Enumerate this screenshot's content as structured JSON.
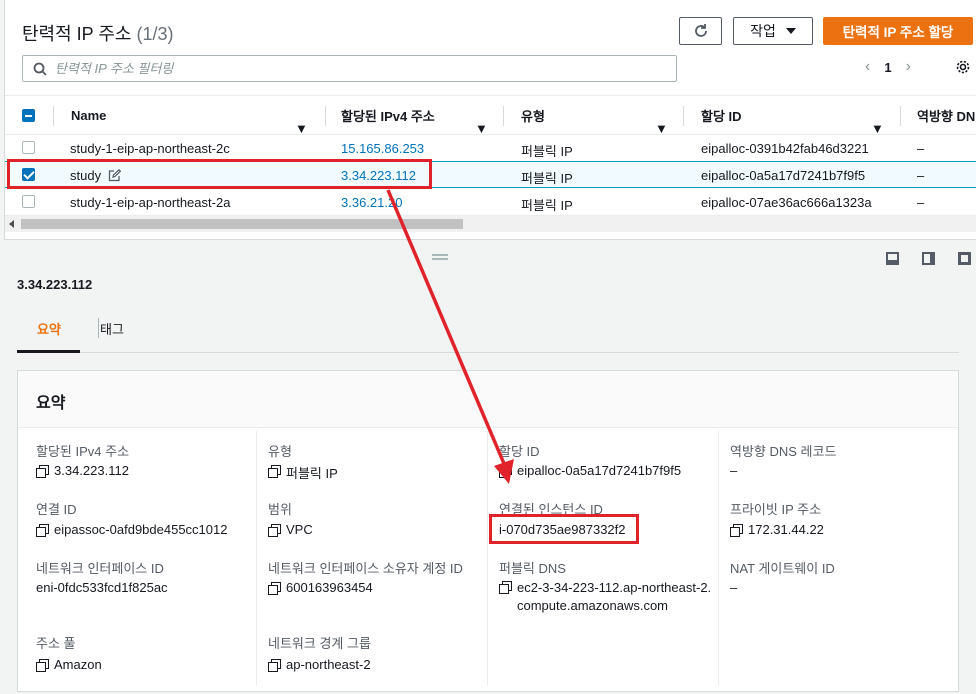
{
  "list": {
    "title": "탄력적 IP 주소",
    "count": "(1/3)",
    "actions_label": "작업",
    "allocate_label": "탄력적 IP 주소 할당",
    "filter_placeholder": "탄력적 IP 주소 필터링",
    "page_number": "1",
    "columns": [
      "Name",
      "할당된 IPv4 주소",
      "유형",
      "할당 ID",
      "역방향 DN"
    ],
    "rows": [
      {
        "name": "study-1-eip-ap-northeast-2c",
        "ip": "15.165.86.253",
        "type": "퍼블릭 IP",
        "allocation_id": "eipalloc-0391b42fab46d3221",
        "reverse_dns": "–",
        "selected": false
      },
      {
        "name": "study",
        "ip": "3.34.223.112",
        "type": "퍼블릭 IP",
        "allocation_id": "eipalloc-0a5a17d7241b7f9f5",
        "reverse_dns": "–",
        "selected": true
      },
      {
        "name": "study-1-eip-ap-northeast-2a",
        "ip": "3.36.21.20",
        "type": "퍼블릭 IP",
        "allocation_id": "eipalloc-07ae36ac666a1323a",
        "reverse_dns": "–",
        "selected": false
      }
    ]
  },
  "detail": {
    "title": "3.34.223.112",
    "tabs": [
      "요약",
      "태그"
    ],
    "summary_title": "요약",
    "fields": {
      "ipv4_label": "할당된 IPv4 주소",
      "ipv4_value": "3.34.223.112",
      "type_label": "유형",
      "type_value": "퍼블릭 IP",
      "alloc_label": "할당 ID",
      "alloc_value": "eipalloc-0a5a17d7241b7f9f5",
      "rdns_label": "역방향 DNS 레코드",
      "rdns_value": "–",
      "assoc_label": "연결 ID",
      "assoc_value": "eipassoc-0afd9bde455cc1012",
      "scope_label": "범위",
      "scope_value": "VPC",
      "instance_label": "연결된 인스턴스 ID",
      "instance_value": "i-070d735ae987332f2",
      "private_ip_label": "프라이빗 IP 주소",
      "private_ip_value": "172.31.44.22",
      "eni_label": "네트워크 인터페이스 ID",
      "eni_value": "eni-0fdc533fcd1f825ac",
      "eni_owner_label": "네트워크 인터페이스 소유자 계정 ID",
      "eni_owner_value": "600163963454",
      "public_dns_label": "퍼블릭 DNS",
      "public_dns_value": "ec2-3-34-223-112.ap-northeast-2.compute.amazonaws.com",
      "nat_label": "NAT 게이트웨이 ID",
      "nat_value": "–",
      "pool_label": "주소 풀",
      "pool_value": "Amazon",
      "border_label": "네트워크 경계 그룹",
      "border_value": "ap-northeast-2"
    }
  },
  "colors": {
    "accent": "#ec7211",
    "link": "#0073bb",
    "annotation": "#e0232b"
  },
  "icons": [
    "refresh-icon",
    "caret-down-icon",
    "search-icon",
    "chevron-left-icon",
    "chevron-right-icon",
    "gear-icon",
    "sort-icon",
    "edit-icon",
    "copy-icon",
    "panel-layout-icon",
    "split-handle-icon"
  ]
}
